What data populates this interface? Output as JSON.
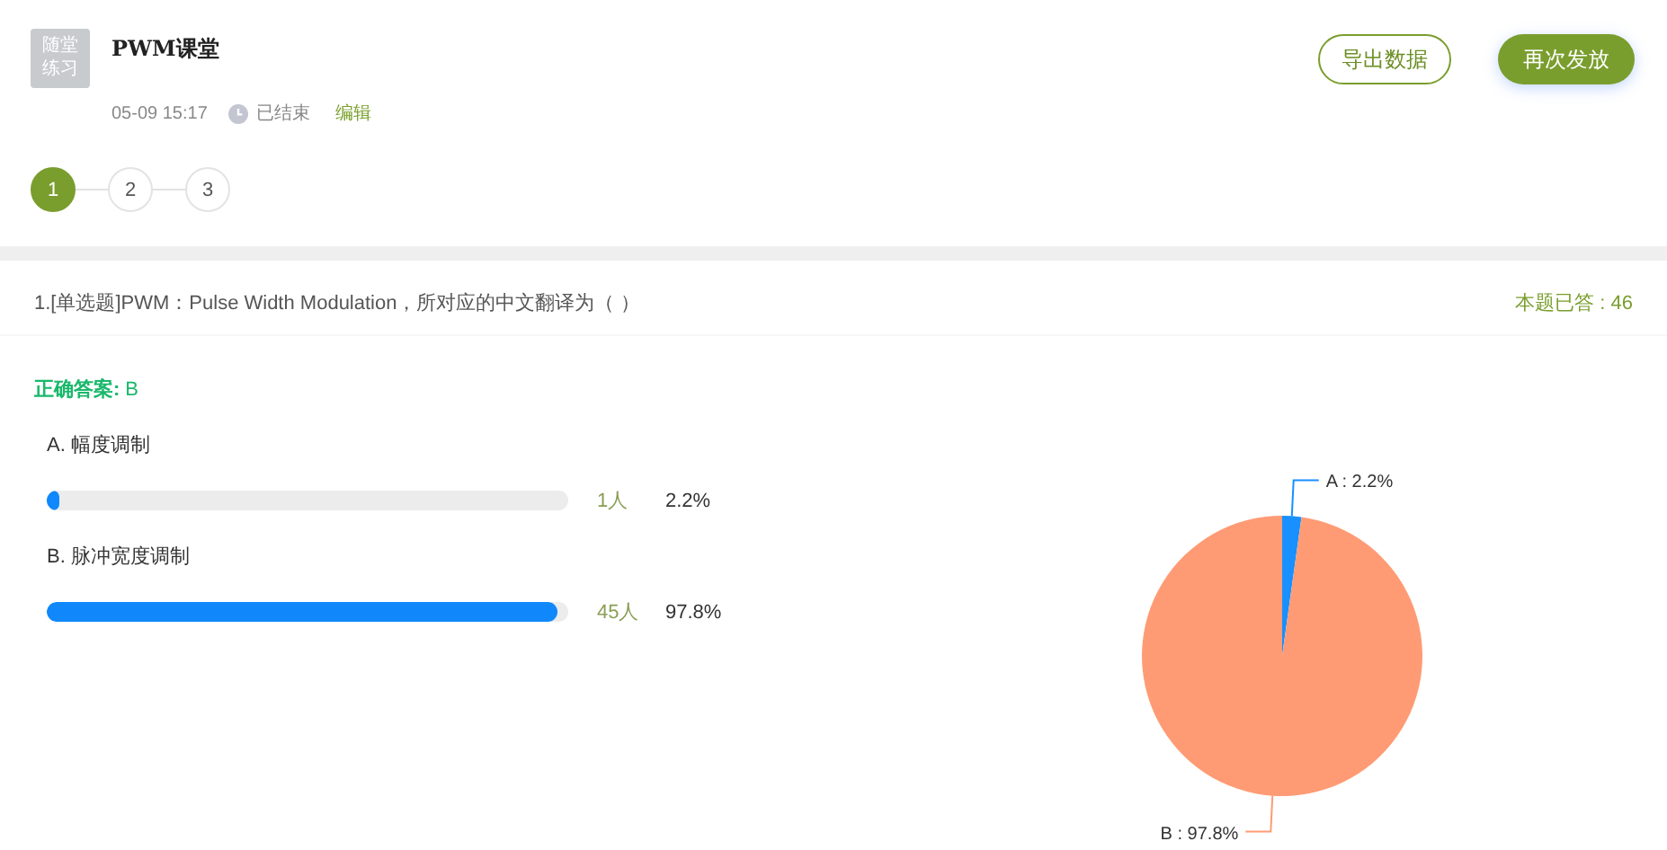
{
  "header": {
    "badge": "随堂练习",
    "title": "PWM课堂",
    "time": "05-09 15:17",
    "status": "已结束",
    "edit_link": "编辑",
    "buttons": [
      {
        "label": "导出数据",
        "kind": "outline"
      },
      {
        "label": "再次发放",
        "kind": "primary"
      }
    ]
  },
  "steps": [
    {
      "label": "1",
      "selected": true
    },
    {
      "label": "2",
      "selected": false
    },
    {
      "label": "3",
      "selected": false
    }
  ],
  "question": {
    "text": "1.[单选题]PWM：Pulse Width Modulation，所对应的中文翻译为（ ）",
    "answered": "本题已答 : 46",
    "correct_label": "正确答案:",
    "correct_value": "B",
    "options": [
      {
        "label": "A. 幅度调制",
        "count": "1人",
        "percent": "2.2%",
        "level": 0.022
      },
      {
        "label": "B. 脉冲宽度调制",
        "count": "45人",
        "percent": "97.8%",
        "level": 0.978
      }
    ],
    "chart_data": {
      "type": "pie",
      "categories": [
        "A : 2.2%",
        "B : 97.8%"
      ],
      "values": [
        2.2,
        97.8
      ],
      "colors": [
        "#1890ff",
        "#ff9b74"
      ]
    }
  }
}
